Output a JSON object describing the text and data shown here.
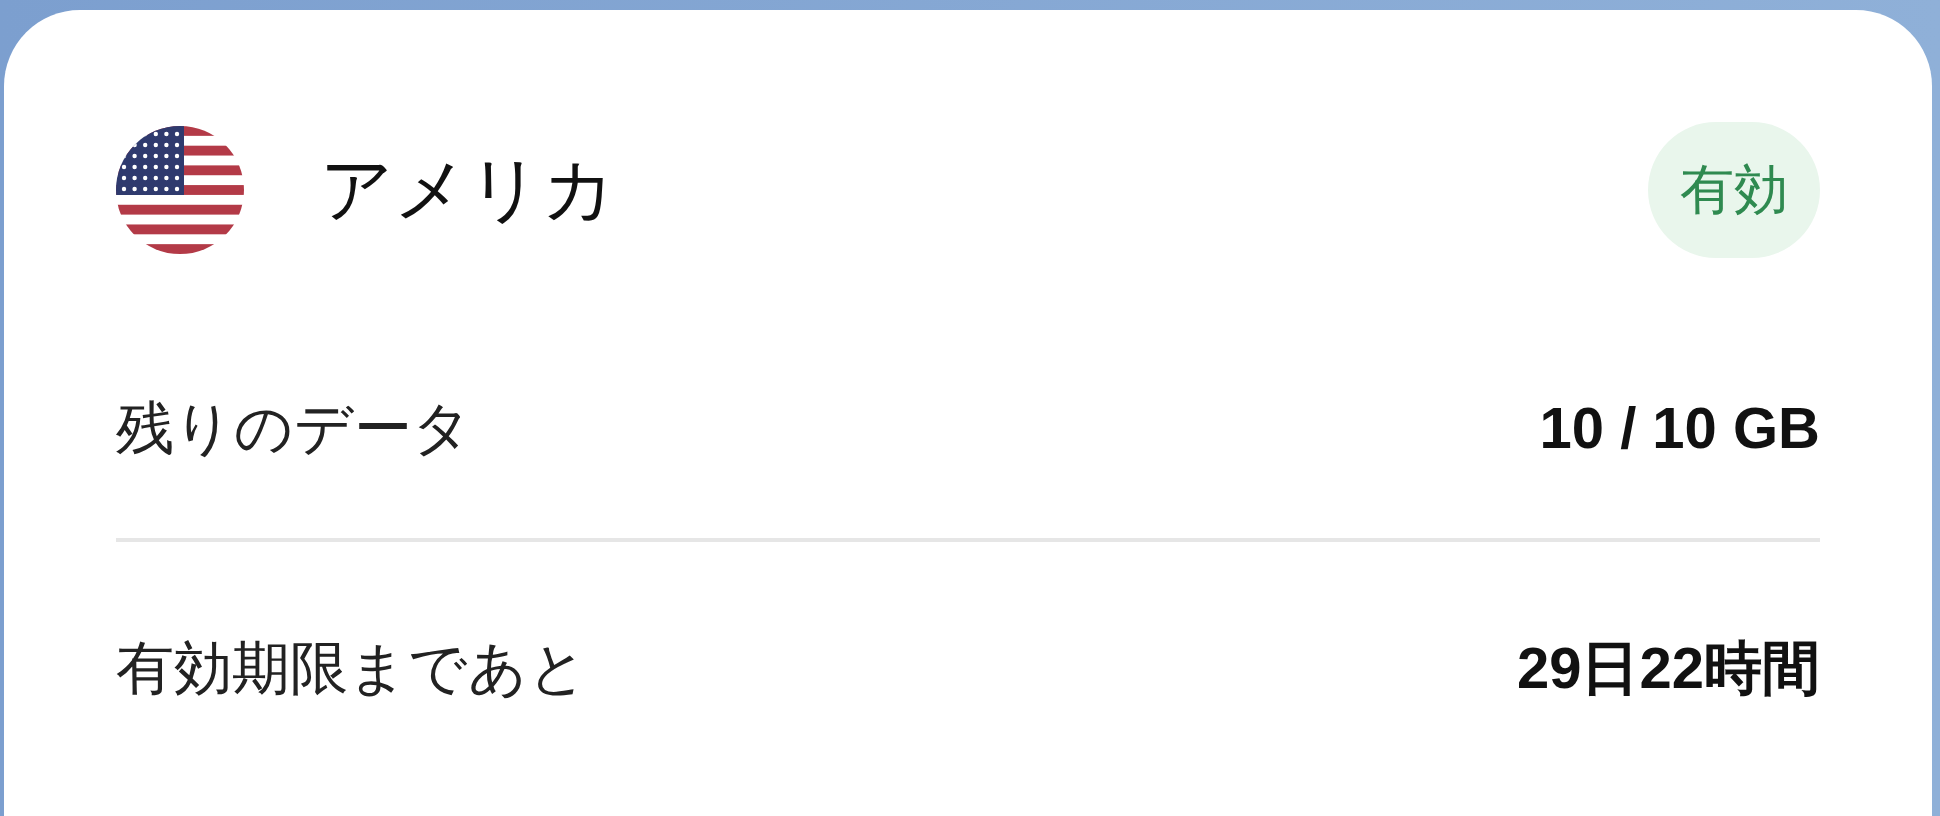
{
  "plan": {
    "country": "アメリカ",
    "status": "有効"
  },
  "rows": [
    {
      "label": "残りのデータ",
      "value": "10 / 10 GB"
    },
    {
      "label": "有効期限まであと",
      "value": "29日22時間"
    }
  ]
}
